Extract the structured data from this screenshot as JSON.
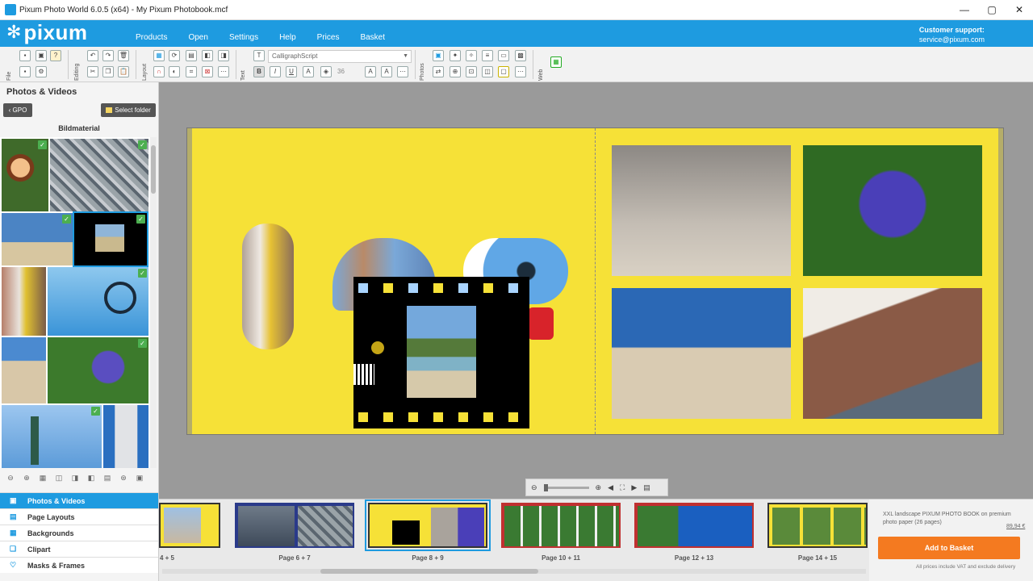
{
  "window": {
    "title": "Pixum Photo World 6.0.5 (x64) - My Pixum Photobook.mcf",
    "controls": [
      "—",
      "▢",
      "✕"
    ]
  },
  "header": {
    "brand": "pixum",
    "menu": [
      "Products",
      "Open",
      "Settings",
      "Help",
      "Prices",
      "Basket"
    ],
    "support_label": "Customer support:",
    "support_email": "service@pixum.com"
  },
  "toolbar": {
    "group_labels": [
      "File",
      "Editing",
      "Layout",
      "Text",
      "Photos",
      "Web"
    ],
    "font_name": "CalligraphScript",
    "font_size": "36"
  },
  "left_panel": {
    "title": "Photos & Videos",
    "gpo_label": "GPO",
    "select_folder_label": "Select folder",
    "material_title": "Bildmaterial",
    "categories": [
      {
        "label": "Photos & Videos",
        "icon": "photos-icon",
        "active": true
      },
      {
        "label": "Page Layouts",
        "icon": "layout-icon",
        "active": false
      },
      {
        "label": "Backgrounds",
        "icon": "background-icon",
        "active": false
      },
      {
        "label": "Clipart",
        "icon": "clipart-icon",
        "active": false
      },
      {
        "label": "Masks & Frames",
        "icon": "heart-icon",
        "active": false
      }
    ]
  },
  "pages": [
    {
      "label": "4 + 5"
    },
    {
      "label": "Page 6 + 7"
    },
    {
      "label": "Page 8 + 9",
      "selected": true
    },
    {
      "label": "Page 10 + 11"
    },
    {
      "label": "Page 12 + 13"
    },
    {
      "label": "Page 14 + 15"
    }
  ],
  "order": {
    "description": "XXL landscape PIXUM PHOTO BOOK on premium photo paper  (26 pages)",
    "price": "89,94 €",
    "add_to_basket": "Add to Basket",
    "note": "All prices include VAT and exclude delivery"
  },
  "colors": {
    "brand_blue": "#1e9be0",
    "page_yellow": "#f6e137",
    "basket_orange": "#f47a20"
  }
}
